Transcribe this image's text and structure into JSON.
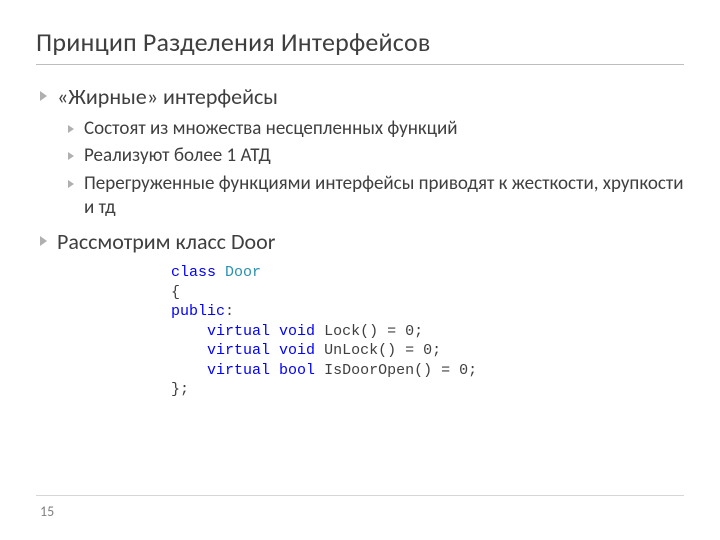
{
  "title": "Принцип Разделения Интерфейсов",
  "bullets": {
    "b1": {
      "text": "«Жирные» интерфейсы",
      "sub": {
        "s1": "Состоят из множества несцепленных функций",
        "s2": "Реализуют более 1 АТД",
        "s3": "Перегруженные функциями интерфейсы приводят к жесткости, хрупкости и тд"
      }
    },
    "b2": {
      "text": "Рассмотрим класс Door"
    }
  },
  "code": {
    "kw_class": "class",
    "cls_name": "Door",
    "brace_open": "{",
    "kw_public": "public",
    "colon": ":",
    "pad": "    ",
    "kw_virtual": "virtual",
    "kw_void": "void",
    "kw_bool": "bool",
    "fn_lock": "Lock",
    "fn_unlock": "UnLock",
    "fn_isopen": "IsDoorOpen",
    "pure": "() = 0;",
    "brace_close": "};"
  },
  "page_number": "15"
}
